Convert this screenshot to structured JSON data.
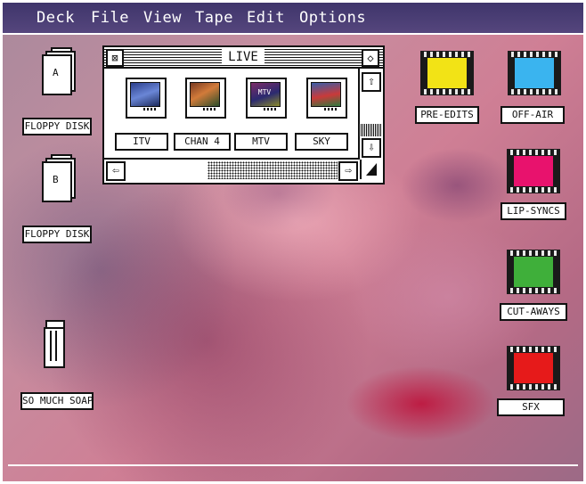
{
  "menu": [
    "Deck",
    "File",
    "View",
    "Tape",
    "Edit",
    "Options"
  ],
  "desktop": {
    "floppy_a": {
      "label": "FLOPPY DISK",
      "letter": "A"
    },
    "floppy_b": {
      "label": "FLOPPY DISK",
      "letter": "B"
    },
    "trash": {
      "label": "SO MUCH SOAP"
    }
  },
  "window": {
    "title": "LIVE",
    "close_glyph": "⊠",
    "full_glyph": "◇",
    "channels": [
      {
        "label": "ITV",
        "screen_text": ""
      },
      {
        "label": "CHAN 4",
        "screen_text": ""
      },
      {
        "label": "MTV",
        "screen_text": "MTV"
      },
      {
        "label": "SKY",
        "screen_text": ""
      }
    ]
  },
  "film_folders": [
    {
      "label": "PRE-EDITS",
      "color": "#f2e316"
    },
    {
      "label": "OFF-AIR",
      "color": "#3ab4ef"
    },
    {
      "label": "LIP-SYNCS",
      "color": "#e8126d"
    },
    {
      "label": "CUT-AWAYS",
      "color": "#3faf3a"
    },
    {
      "label": "SFX",
      "color": "#e61a1a"
    }
  ],
  "colors": {
    "menubar": "#3f356b",
    "desktop": "#c68ea0"
  }
}
